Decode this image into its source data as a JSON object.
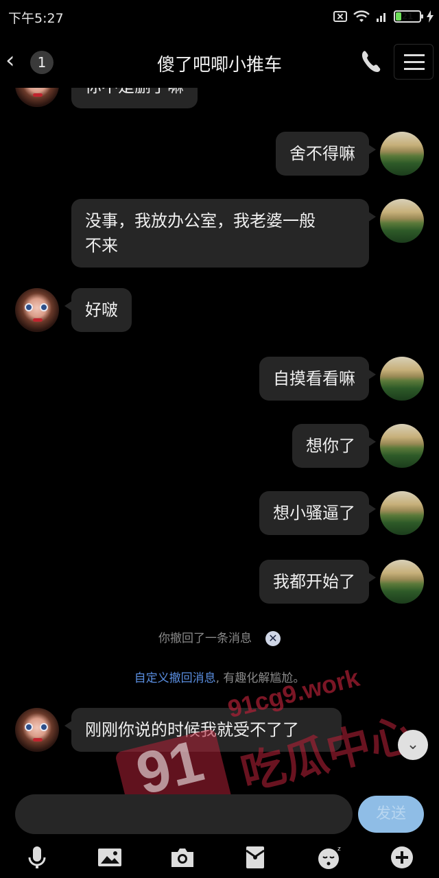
{
  "status_bar": {
    "time": "下午5:27",
    "battery": "21"
  },
  "header": {
    "back_count": "1",
    "title": "傻了吧唧小推车"
  },
  "messages": [
    {
      "side": "left",
      "text": "你不是删了嘛"
    },
    {
      "side": "right",
      "text": "舍不得嘛"
    },
    {
      "side": "right",
      "text": "没事，我放办公室，我老婆一般\n不来"
    },
    {
      "side": "left",
      "text": "好啵"
    },
    {
      "side": "right",
      "text": "自摸看看嘛"
    },
    {
      "side": "right",
      "text": "想你了"
    },
    {
      "side": "right",
      "text": "想小骚逼了"
    },
    {
      "side": "right",
      "text": "我都开始了"
    },
    {
      "side": "left",
      "text": "刚刚你说的时候我就受不了了"
    }
  ],
  "system": {
    "recalled": "你撤回了一条消息",
    "custom_link": "自定义撤回消息",
    "custom_rest": ", 有趣化解尴尬。"
  },
  "input": {
    "send_label": "发送"
  },
  "toolbar": [
    "mic-icon",
    "image-icon",
    "camera-icon",
    "red-packet-icon",
    "emoji-icon",
    "plus-icon"
  ],
  "watermark": {
    "big": "91",
    "url": "91cg9.work",
    "cn": "吃瓜中心"
  },
  "colors": {
    "bubble": "#262626",
    "link": "#5a8ee0",
    "send": "#8fbde6"
  }
}
